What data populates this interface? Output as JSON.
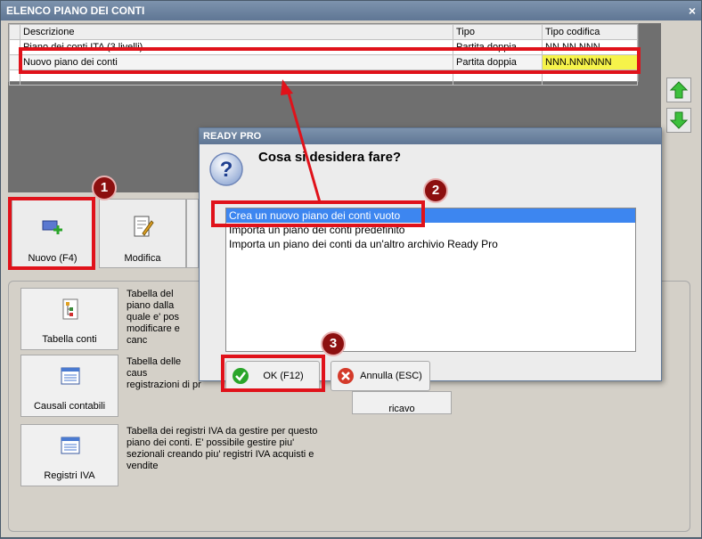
{
  "window": {
    "title": "ELENCO PIANO DEI CONTI",
    "close_glyph": "×"
  },
  "grid": {
    "columns": [
      "Descrizione",
      "Tipo",
      "Tipo codifica"
    ],
    "rows": [
      {
        "descrizione": "Piano dei conti ITA (3 livelli)",
        "tipo": "Partita doppia",
        "codifica": "NN.NN.NNN"
      },
      {
        "descrizione": "Nuovo piano dei conti",
        "tipo": "Partita doppia",
        "codifica": "NNN.NNNNNN"
      }
    ]
  },
  "toolbar": {
    "nuovo_label": "Nuovo (F4)",
    "modifica_label": "Modifica"
  },
  "side": {
    "tabella_conti": {
      "label": "Tabella conti",
      "desc": "Tabella del piano dalla quale e' pos modificare e canc"
    },
    "causali": {
      "label": "Causali contabili",
      "desc": "Tabella delle caus registrazioni di pr"
    },
    "registri": {
      "label": "Registri IVA",
      "desc": "Tabella dei registri IVA da gestire per questo piano dei conti. E' possibile gestire piu' sezionali creando piu' registri IVA acquisti e vendite"
    },
    "partial_label": "ricavo"
  },
  "dialog": {
    "title": "READY PRO",
    "question": "Cosa si desidera fare?",
    "options": [
      "Crea un nuovo piano dei conti vuoto",
      "Importa un piano dei conti predefinito",
      "Importa un piano dei conti da un'altro archivio Ready Pro"
    ],
    "ok_label": "OK (F12)",
    "cancel_label": "Annulla (ESC)"
  },
  "annotations": {
    "step1": "1",
    "step2": "2",
    "step3": "3"
  },
  "colors": {
    "highlight_yellow": "#f6f34a",
    "annotation_red": "#e0121a",
    "selection_blue": "#3d86f0"
  }
}
